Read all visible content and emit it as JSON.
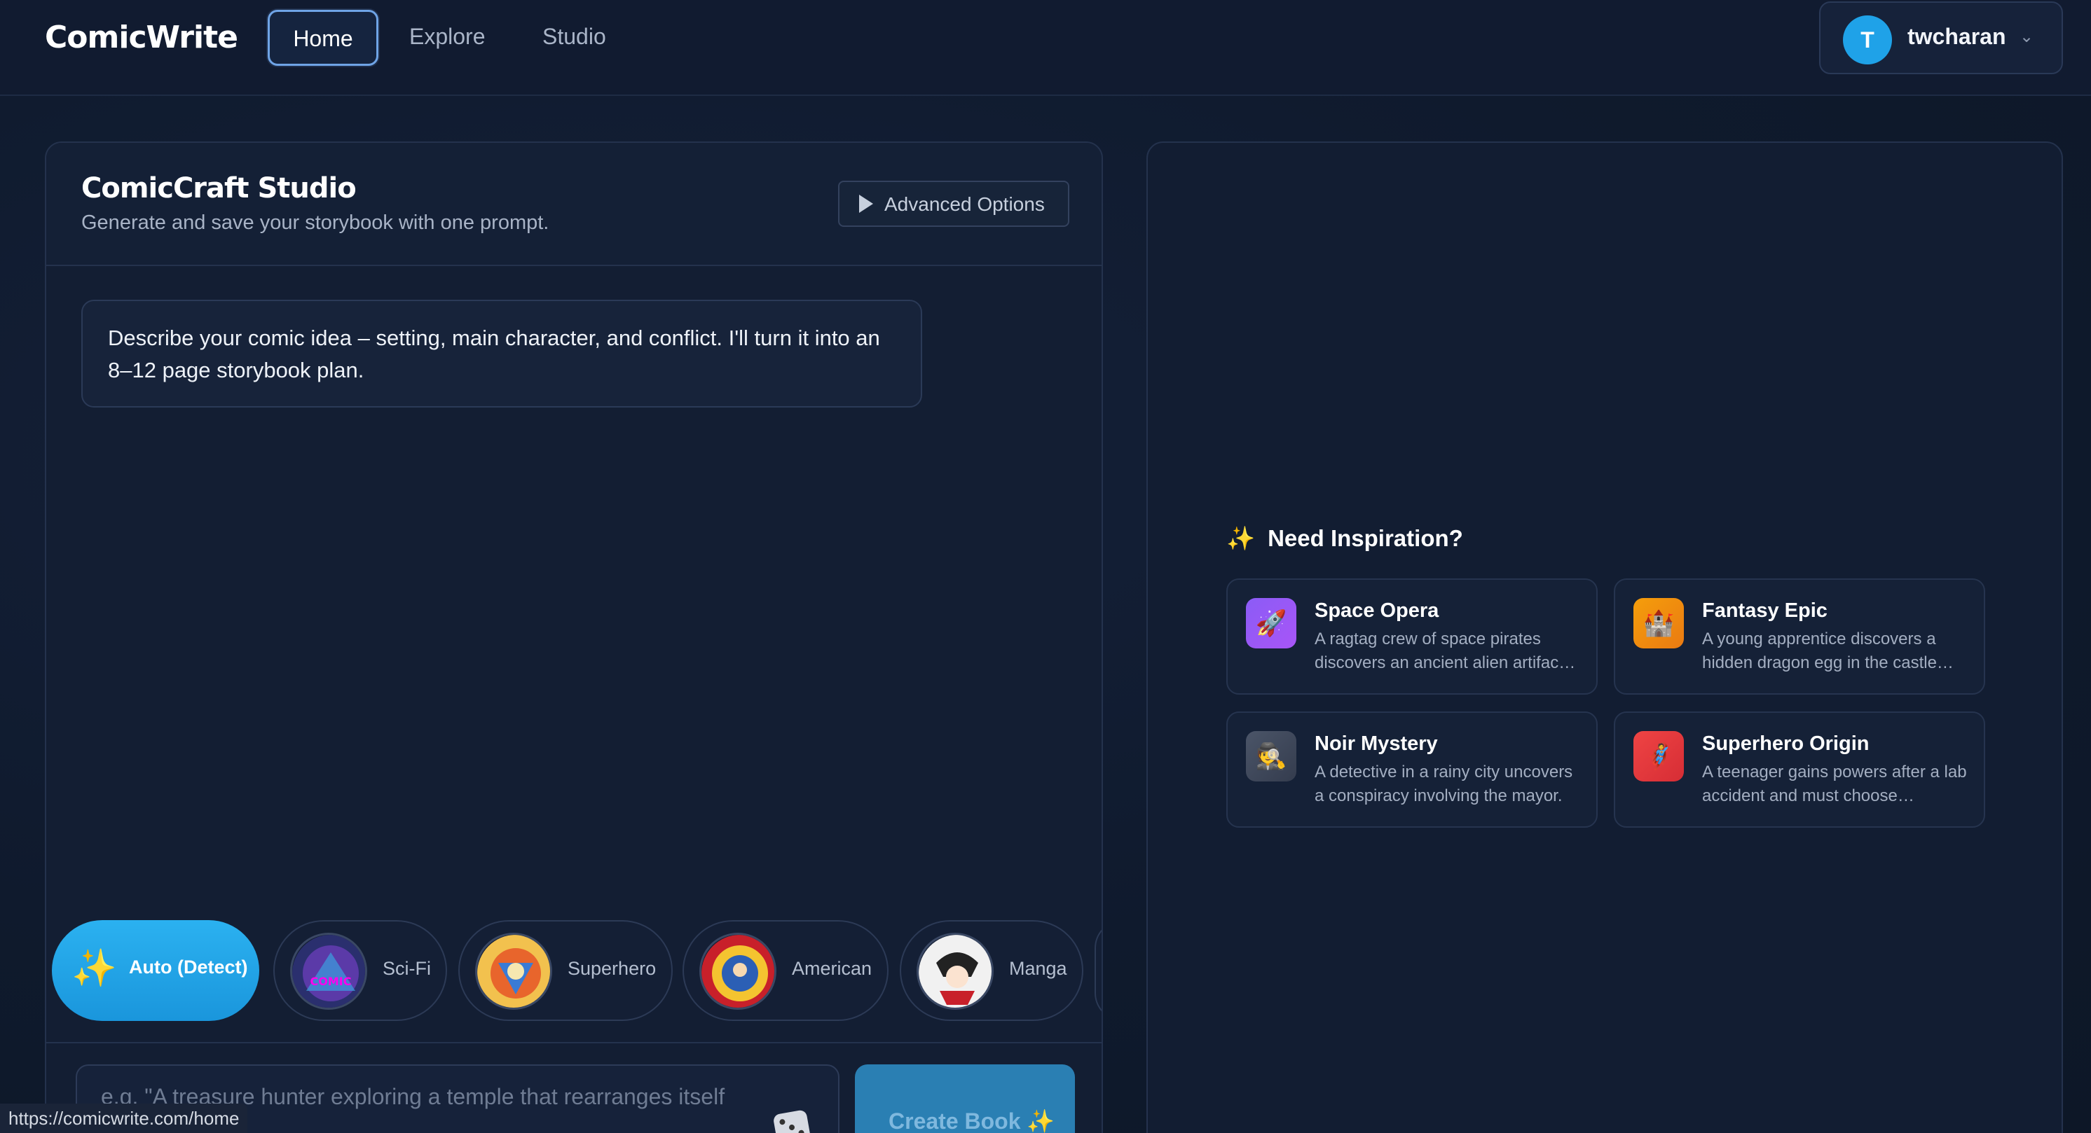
{
  "nav": {
    "brand": "ComicWrite",
    "tabs": [
      "Home",
      "Explore",
      "Studio"
    ],
    "active_tab": "Home",
    "user": {
      "initial": "T",
      "name": "twcharan",
      "chevron": "⌄"
    }
  },
  "studio": {
    "title": "ComicCraft Studio",
    "subtitle": "Generate and save your storybook with one prompt.",
    "advanced_label": "Advanced Options",
    "assistant_message": "Describe your comic idea – setting, main character, and conflict. I'll turn it into an 8–12 page storybook plan.",
    "styles": [
      {
        "label": "Auto (Detect)",
        "icon": "sparkles-icon",
        "selected": true
      },
      {
        "label": "Sci-Fi"
      },
      {
        "label": "Superhero"
      },
      {
        "label": "American"
      },
      {
        "label": "Manga"
      }
    ],
    "input_placeholder": "e.g. \"A treasure hunter exploring a temple that rearranges itself",
    "create_label": "Create Book",
    "create_icon": "✨"
  },
  "inspiration": {
    "title": "Need Inspiration?",
    "icon": "✨",
    "cards": [
      {
        "title": "Space Opera",
        "description": "A ragtag crew of space pirates discovers an ancient alien artifac…",
        "icon": "🚀",
        "color": "#8b5cf6"
      },
      {
        "title": "Fantasy Epic",
        "description": "A young apprentice discovers a hidden dragon egg in the castle…",
        "icon": "🏰",
        "color": "#f59e0b"
      },
      {
        "title": "Noir Mystery",
        "description": "A detective in a rainy city uncovers a conspiracy involving the mayor.",
        "icon": "🕵",
        "color": "#4b5568"
      },
      {
        "title": "Superhero Origin",
        "description": "A teenager gains powers after a lab accident and must choose…",
        "icon": "🦸",
        "color": "#ef4444"
      }
    ]
  },
  "status_bar": {
    "url": "https://comicwrite.com/home"
  },
  "colors": {
    "accent": "#1fa2e8",
    "background": "#111b2e",
    "create_button": "#2a7fb3"
  }
}
